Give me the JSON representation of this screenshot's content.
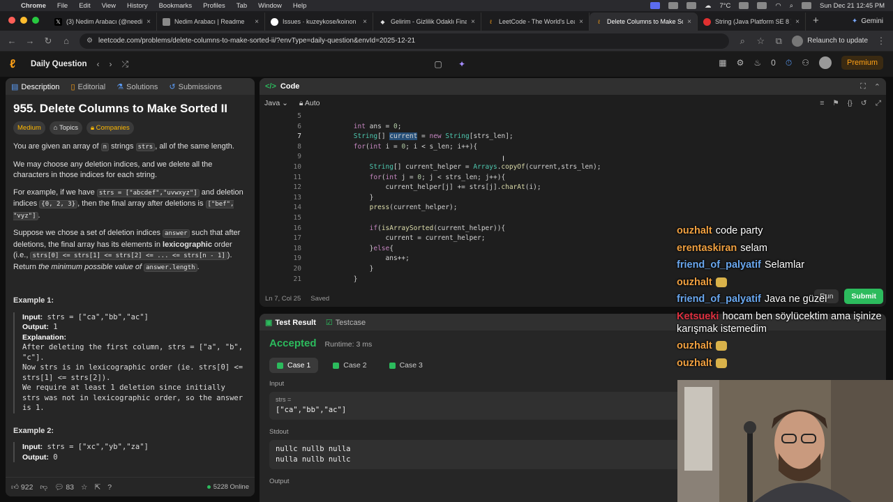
{
  "menubar": {
    "app": "Chrome",
    "items": [
      "File",
      "Edit",
      "View",
      "History",
      "Bookmarks",
      "Profiles",
      "Tab",
      "Window",
      "Help"
    ],
    "weather": "7°C",
    "datetime": "Sun Dec 21  12:45 PM"
  },
  "tabs": [
    {
      "title": "(3) Nedim Arabacı (@needim",
      "favicon": "x-icon",
      "color": "#000000"
    },
    {
      "title": "Nedim Arabacı | Readme",
      "favicon": "readme-icon",
      "color": "#8a8a8a"
    },
    {
      "title": "Issues · kuzeykose/koinon",
      "favicon": "github-icon",
      "color": "#333333"
    },
    {
      "title": "Gelirim - Gizlilik Odaklı Finan",
      "favicon": "gelirim-icon",
      "color": "#333333"
    },
    {
      "title": "LeetCode - The World's Lea",
      "favicon": "leetcode-icon",
      "color": "#ffa116"
    },
    {
      "title": "Delete Columns to Make Sor",
      "favicon": "leetcode-icon",
      "color": "#ffa116",
      "active": true
    },
    {
      "title": "String (Java Platform SE 8 )",
      "favicon": "java-icon",
      "color": "#e03030"
    }
  ],
  "gemini_label": "Gemini",
  "address": {
    "url": "leetcode.com/problems/delete-columns-to-make-sorted-ii/?envType=daily-question&envId=2025-12-21",
    "relaunch": "Relaunch to update"
  },
  "lcnav": {
    "daily": "Daily Question",
    "streak": "0",
    "premium": "Premium"
  },
  "left": {
    "tabs": [
      "Description",
      "Editorial",
      "Solutions",
      "Submissions"
    ],
    "title": "955. Delete Columns to Make Sorted II",
    "badges": [
      "Medium",
      "Topics",
      "Companies"
    ],
    "p1a": "You are given an array of ",
    "p1n": "n",
    "p1b": " strings ",
    "p1c": "strs",
    "p1d": ", all of the same length.",
    "p2": "We may choose any deletion indices, and we delete all the characters in those indices for each string.",
    "p3a": "For example, if we have ",
    "p3b": "strs = [\"abcdef\",\"uvwxyz\"]",
    "p3c": " and deletion indices ",
    "p3d": "{0, 2, 3}",
    "p3e": ", then the final array after deletions is ",
    "p3f": "[\"bef\", \"vyz\"]",
    "p3g": ".",
    "p4a": "Suppose we chose a set of deletion indices ",
    "p4b": "answer",
    "p4c": " such that after deletions, the final array has its elements in ",
    "p4d": "lexicographic",
    "p4e": " order (i.e., ",
    "p4f": "strs[0] <= strs[1] <= strs[2] <= ... <= strs[n - 1]",
    "p4g": "). Return ",
    "p4h": "the minimum possible value of",
    "p4i": " ",
    "p4j": "answer.length",
    "p4k": ".",
    "ex1_title": "Example 1:",
    "ex1_input_label": "Input:",
    "ex1_input": " strs = [\"ca\",\"bb\",\"ac\"]",
    "ex1_output_label": "Output:",
    "ex1_output": " 1",
    "ex1_expl_label": "Explanation:",
    "ex1_expl": "After deleting the first column, strs = [\"a\", \"b\", \"c\"].\nNow strs is in lexicographic order (ie. strs[0] <= strs[1] <= strs[2]).\nWe require at least 1 deletion since initially strs was not in lexicographic order, so the answer is 1.",
    "ex2_title": "Example 2:",
    "ex2_input_label": "Input:",
    "ex2_input": " strs = [\"xc\",\"yb\",\"za\"]",
    "ex2_output_label": "Output:",
    "ex2_output": " 0",
    "likes": "922",
    "comments": "83",
    "online": "5228 Online"
  },
  "code": {
    "header": "Code",
    "lang": "Java",
    "mode": "Auto",
    "status": "Ln 7, Col 25",
    "saved": "Saved",
    "run": "Run",
    "submit": "Submit",
    "lines": [
      {
        "n": "5",
        "t": ""
      },
      {
        "n": "6",
        "t": "        int ans = 0;"
      },
      {
        "n": "7",
        "t": "        String[] current = new String[strs_len];"
      },
      {
        "n": "8",
        "t": "        for(int i = 0; i < s_len; i++){"
      },
      {
        "n": "9",
        "t": ""
      },
      {
        "n": "10",
        "t": "            String[] current_helper = Arrays.copyOf(current,strs_len);"
      },
      {
        "n": "11",
        "t": "            for(int j = 0; j < strs_len; j++){"
      },
      {
        "n": "12",
        "t": "                current_helper[j] += strs[j].charAt(i);"
      },
      {
        "n": "13",
        "t": "            }"
      },
      {
        "n": "14",
        "t": "            press(current_helper);"
      },
      {
        "n": "15",
        "t": ""
      },
      {
        "n": "16",
        "t": "            if(isArraySorted(current_helper)){"
      },
      {
        "n": "17",
        "t": "                current = current_helper;"
      },
      {
        "n": "18",
        "t": "            }else{"
      },
      {
        "n": "19",
        "t": "                ans++;"
      },
      {
        "n": "20",
        "t": "            }"
      },
      {
        "n": "21",
        "t": "        }"
      }
    ]
  },
  "test": {
    "tabs": [
      "Test Result",
      "Testcase"
    ],
    "verdict": "Accepted",
    "runtime": "Runtime: 3 ms",
    "cases": [
      "Case 1",
      "Case 2",
      "Case 3"
    ],
    "input_label": "Input",
    "input_var": "strs =",
    "input_val": "[\"ca\",\"bb\",\"ac\"]",
    "stdout_label": "Stdout",
    "stdout_val": "nullc nullb nulla\nnulla nullb nullc",
    "output_label": "Output"
  },
  "chat": [
    {
      "user": "ouzhalt",
      "color": "orange",
      "text": "code party"
    },
    {
      "user": "erentaskiran",
      "color": "orange",
      "text": "selam"
    },
    {
      "user": "friend_of_palyatif",
      "color": "blue",
      "text": "Selamlar"
    },
    {
      "user": "ouzhalt",
      "color": "orange",
      "text": "",
      "emote": true
    },
    {
      "user": "friend_of_palyatif",
      "color": "blue",
      "text": "Java ne güzel"
    },
    {
      "user": "Ketsueki",
      "color": "red",
      "text": "hocam ben söylücektim ama işinize karışmak istemedim"
    },
    {
      "user": "ouzhalt",
      "color": "orange",
      "text": "",
      "emote": true
    },
    {
      "user": "ouzhalt",
      "color": "orange",
      "text": "",
      "emote": true
    }
  ]
}
